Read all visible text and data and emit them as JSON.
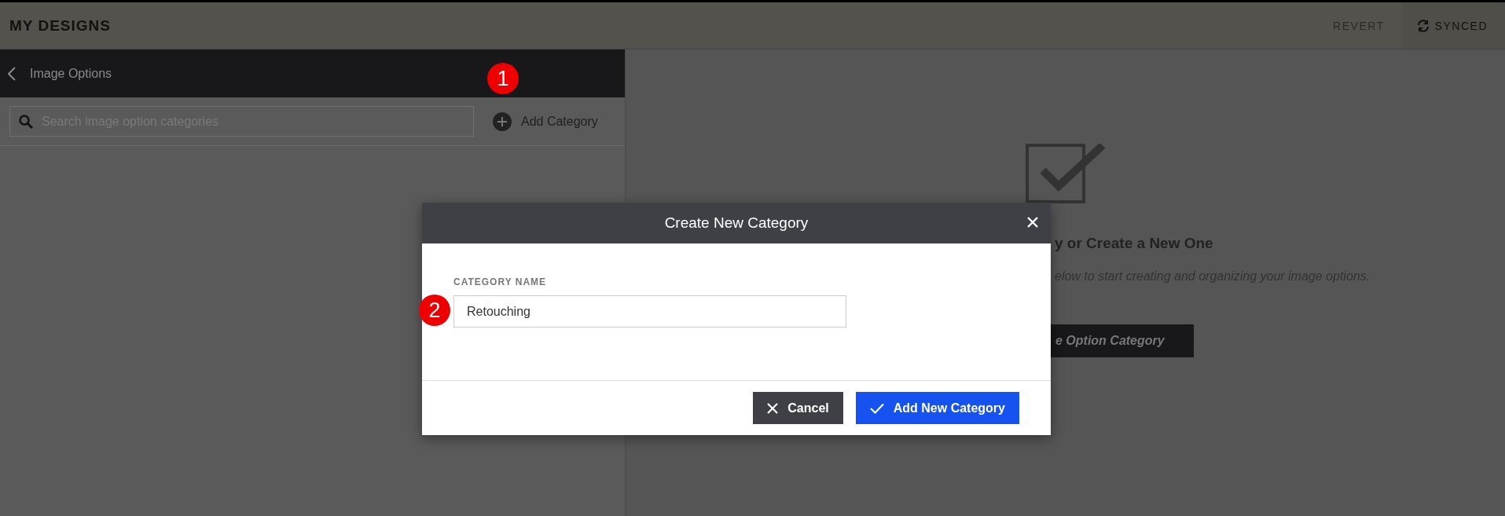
{
  "top_bar": {
    "title": "MY DESIGNS",
    "revert": {
      "label": "REVERT",
      "disabled": true
    },
    "sync": {
      "label": "SYNCED"
    }
  },
  "sidebar": {
    "back_title": "Image Options",
    "search": {
      "placeholder": "Search image option categories"
    },
    "add_button": "Add Category"
  },
  "empty_state": {
    "heading": "y or Create a New One",
    "description": "elow to start creating and organizing your image options.",
    "button": "e Option Category"
  },
  "dialog": {
    "title": "Create New Category",
    "field_label": "CATEGORY NAME",
    "field_value": "Retouching",
    "buttons": [
      {
        "kind": "cancel",
        "label": "Cancel"
      },
      {
        "kind": "confirm",
        "label": "Add New Category"
      }
    ]
  },
  "step_markers": [
    {
      "label": "1"
    },
    {
      "label": "2"
    }
  ]
}
